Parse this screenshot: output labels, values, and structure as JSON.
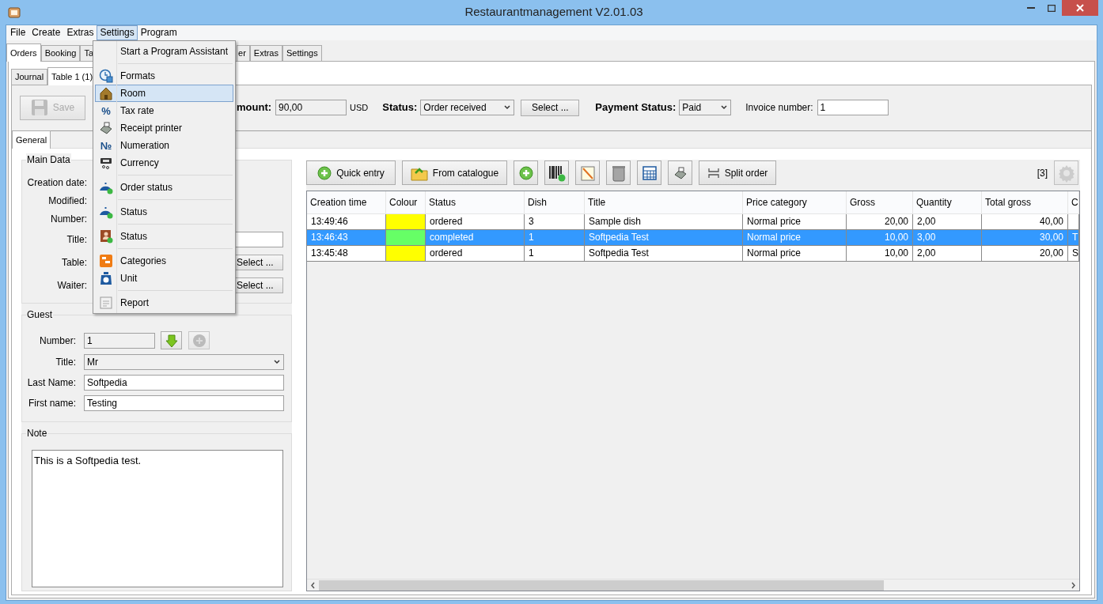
{
  "window": {
    "title": "Restaurantmanagement V2.01.03"
  },
  "menubar": [
    {
      "label": "File",
      "selected": false
    },
    {
      "label": "Create",
      "selected": false
    },
    {
      "label": "Extras",
      "selected": false
    },
    {
      "label": "Settings",
      "selected": true
    },
    {
      "label": "Program",
      "selected": false
    }
  ],
  "settings_menu": {
    "groups": [
      [
        {
          "label": "Start a Program Assistant",
          "selected": false
        }
      ],
      [
        {
          "label": "Formats",
          "selected": false
        },
        {
          "label": "Room",
          "selected": true
        },
        {
          "label": "Tax rate",
          "selected": false,
          "glyph": "%"
        },
        {
          "label": "Receipt printer",
          "selected": false
        },
        {
          "label": "Numeration",
          "selected": false,
          "glyph": "№"
        },
        {
          "label": "Currency",
          "selected": false
        }
      ],
      [
        {
          "label": "Order status",
          "selected": false
        }
      ],
      [
        {
          "label": "Status",
          "selected": false
        }
      ],
      [
        {
          "label": "Status",
          "selected": false
        }
      ],
      [
        {
          "label": "Categories",
          "selected": false
        },
        {
          "label": "Unit",
          "selected": false
        }
      ],
      [
        {
          "label": "Report",
          "selected": false
        }
      ]
    ]
  },
  "main_tabs": [
    {
      "label": "Orders",
      "selected": true
    },
    {
      "label": "Booking",
      "selected": false
    },
    {
      "label": "Ta",
      "selected": false
    },
    {
      "label": "er",
      "selected": false
    },
    {
      "label": "Extras",
      "selected": false
    },
    {
      "label": "Settings",
      "selected": false
    }
  ],
  "sub_tabs": [
    {
      "label": "Journal",
      "selected": false
    },
    {
      "label": "Table 1 (1)",
      "selected": true
    }
  ],
  "save_button": {
    "label": "Save",
    "disabled": true
  },
  "order_header": {
    "amount_label": "mount:",
    "amount_value": "90,00",
    "currency": "USD",
    "status_label": "Status:",
    "status_value": "Order received",
    "select_button": "Select ...",
    "payment_label": "Payment Status:",
    "payment_value": "Paid",
    "invoice_label": "Invoice number:",
    "invoice_value": "1"
  },
  "detail_tabs": [
    {
      "label": "General",
      "selected": true
    }
  ],
  "main_data": {
    "title": "Main Data",
    "rows": [
      {
        "label": "Creation date:"
      },
      {
        "label": "Modified:"
      },
      {
        "label": "Number:"
      },
      {
        "label": "Title:",
        "kind": "field"
      },
      {
        "label": "Table:",
        "kind": "button",
        "button": "Select ..."
      },
      {
        "label": "Waiter:",
        "kind": "button",
        "button": "Select ..."
      }
    ]
  },
  "guest": {
    "title": "Guest",
    "number_label": "Number:",
    "number_value": "1",
    "title_label": "Title:",
    "title_value": "Mr",
    "last_name_label": "Last Name:",
    "last_name_value": "Softpedia",
    "first_name_label": "First name:",
    "first_name_value": "Testing"
  },
  "note": {
    "title": "Note",
    "text": "This is a Softpedia test."
  },
  "toolbar": {
    "quick_entry": "Quick entry",
    "from_catalogue": "From catalogue",
    "split_order": "Split order",
    "count": "[3]"
  },
  "table": {
    "columns": [
      "Creation time",
      "Colour",
      "Status",
      "Dish",
      "Title",
      "Price category",
      "Gross",
      "Quantity",
      "Total gross",
      "C"
    ],
    "rows": [
      {
        "selected": false,
        "color": "#ffff00",
        "cells": [
          "13:49:46",
          "",
          "ordered",
          "3",
          "Sample dish",
          "Normal price",
          "20,00",
          "2,00",
          "40,00",
          ""
        ]
      },
      {
        "selected": true,
        "color": "#66ff66",
        "cells": [
          "13:46:43",
          "",
          "completed",
          "1",
          "Softpedia Test",
          "Normal price",
          "10,00",
          "3,00",
          "30,00",
          "T"
        ]
      },
      {
        "selected": false,
        "color": "#ffff00",
        "cells": [
          "13:45:48",
          "",
          "ordered",
          "1",
          "Softpedia Test",
          "Normal price",
          "10,00",
          "2,00",
          "20,00",
          "S"
        ]
      }
    ]
  }
}
